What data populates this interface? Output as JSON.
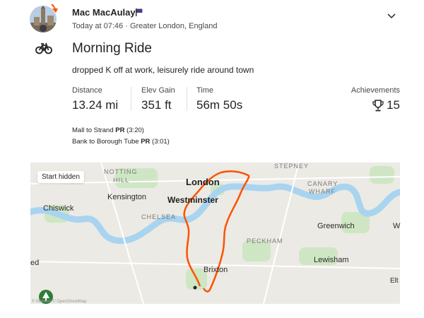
{
  "header": {
    "athlete_name": "Mac MacAulay",
    "meta": "Today at 07:46 · Greater London, England"
  },
  "activity": {
    "type_icon": "bike-icon",
    "title": "Morning Ride",
    "description": "dropped K off at work, leisurely ride around town"
  },
  "stats": {
    "distance": {
      "label": "Distance",
      "value": "13.24 mi"
    },
    "elevation": {
      "label": "Elev Gain",
      "value": "351 ft"
    },
    "time": {
      "label": "Time",
      "value": "56m 50s"
    },
    "achievements": {
      "label": "Achievements",
      "value": "15"
    }
  },
  "segments": [
    {
      "name": "Mall to Strand",
      "badge": "PR",
      "time": "(3:20)"
    },
    {
      "name": "Bank to Borough Tube",
      "badge": "PR",
      "time": "(3:01)"
    }
  ],
  "map": {
    "overlay_button": "Start hidden",
    "attribution": "© Mapbox © OpenStreetMap",
    "labels": {
      "notting": "NOTTING",
      "hill": "HILL",
      "london": "London",
      "stepney": "STEPNEY",
      "canary": "CANARY",
      "wharf": "WHARF",
      "kensington": "Kensington",
      "westminster": "Westminster",
      "chiswick": "Chiswick",
      "chelsea": "CHELSEA",
      "greenwich": "Greenwich",
      "w": "W",
      "peckham": "PECKHAM",
      "ed": "ed",
      "brixton": "Brixton",
      "lewisham": "Lewisham",
      "elt": "Elt"
    },
    "route_color": "#fc5200",
    "water_color": "#a8d4f0",
    "park_color": "#cfe6c4"
  },
  "colors": {
    "accent": "#fc5200",
    "text": "#242428",
    "muted": "#494950"
  }
}
